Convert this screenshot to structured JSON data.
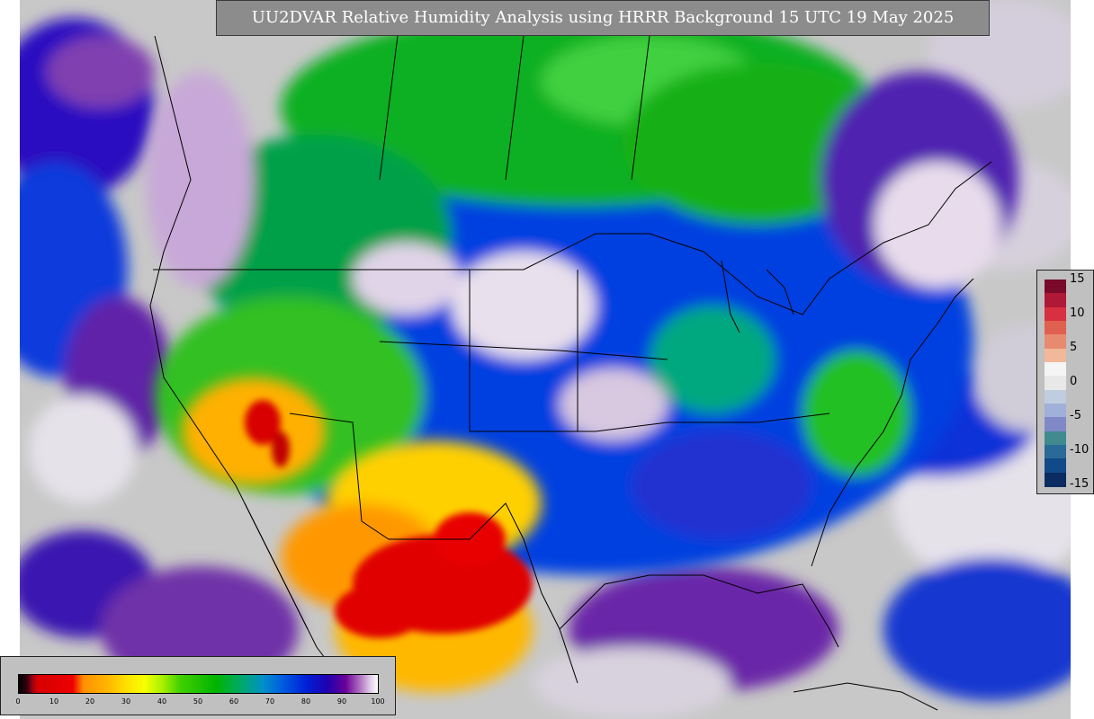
{
  "title": "UU2DVAR Relative Humidity Analysis using HRRR Background 15 UTC 19 May 2025",
  "rh_colorbar": {
    "ticks": [
      "0",
      "10",
      "20",
      "30",
      "40",
      "50",
      "60",
      "70",
      "80",
      "90",
      "100"
    ],
    "min": 0,
    "max": 100
  },
  "difference_colorbar": {
    "labels": [
      "15",
      "10",
      "5",
      "0",
      "-5",
      "-10",
      "-15"
    ],
    "colors": [
      "#7a0a2a",
      "#b01838",
      "#d83040",
      "#e06050",
      "#e88a70",
      "#f2b89a",
      "#f5f5f5",
      "#e8e8e8",
      "#c0cce0",
      "#a0b0d8",
      "#8088c8",
      "#408a90",
      "#2a6a98",
      "#104a88",
      "#0a2c60"
    ]
  },
  "colors": {
    "frame_background": "#c8c8c8",
    "title_background": "#8c8c8c",
    "dry_red": "#e00000",
    "moist_green": "#10b010",
    "humid_blue": "#0030e0",
    "saturated_purple": "#6a0098",
    "near_saturated_white": "#f4f0f4"
  }
}
